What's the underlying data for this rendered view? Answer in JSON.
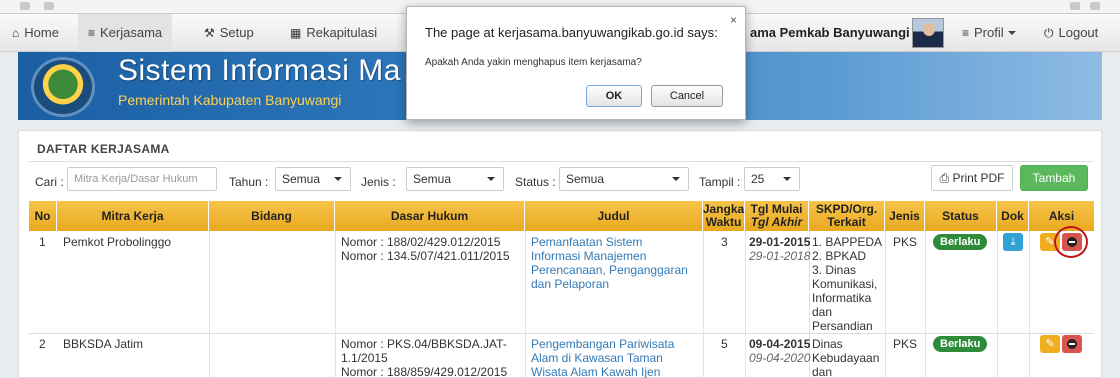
{
  "navbar": {
    "home": "Home",
    "kerjasama": "Kerjasama",
    "setup": "Setup",
    "rekapitulasi": "Rekapitulasi",
    "user": "ama Pemkab Banyuwangi",
    "profil": "Profil",
    "logout": "Logout"
  },
  "banner": {
    "title": "Sistem Informasi Ma",
    "subtitle": "Pemerintah Kabupaten Banyuwangi"
  },
  "dialog": {
    "title": "The page at kerjasama.banyuwangikab.go.id says:",
    "message": "Apakah Anda yakin menghapus item kerjasama?",
    "ok": "OK",
    "cancel": "Cancel",
    "close": "×"
  },
  "panel": {
    "title": "DAFTAR KERJASAMA"
  },
  "filters": {
    "cari_label": "Cari :",
    "cari_placeholder": "Mitra Kerja/Dasar Hukum",
    "tahun_label": "Tahun :",
    "tahun_value": "Semua",
    "jenis_label": "Jenis :",
    "jenis_value": "Semua",
    "status_label": "Status :",
    "status_value": "Semua",
    "tampil_label": "Tampil :",
    "tampil_value": "25",
    "print": "Print PDF",
    "tambah": "Tambah"
  },
  "table": {
    "headers": {
      "no": "No",
      "mitra": "Mitra Kerja",
      "bidang": "Bidang",
      "dasar": "Dasar Hukum",
      "judul": "Judul",
      "jangka_1": "Jangka",
      "jangka_2": "Waktu",
      "tgl_1": "Tgl Mulai",
      "tgl_2": "Tgl Akhir",
      "skpd_1": "SKPD/Org.",
      "skpd_2": "Terkait",
      "jenis": "Jenis",
      "status": "Status",
      "dok": "Dok",
      "aksi": "Aksi"
    },
    "rows": [
      {
        "no": "1",
        "mitra": "Pemkot Probolinggo",
        "dasar_1": "Nomor : 188/02/429.012/2015",
        "dasar_2": "Nomor : 134.5/07/421.011/2015",
        "judul": [
          "Pemanfaatan Sistem",
          "Informasi Manajemen",
          "Perencanaan, Penganggaran",
          "dan Pelaporan"
        ],
        "jangka": "3",
        "tgl_mulai": "29-01-2015",
        "tgl_akhir": "29-01-2018",
        "skpd": [
          "1. BAPPEDA",
          "2. BPKAD",
          "3. Dinas",
          "Komunikasi,",
          "Informatika",
          "dan",
          "Persandian"
        ],
        "jenis": "PKS",
        "status": "Berlaku"
      },
      {
        "no": "2",
        "mitra": "BBKSDA Jatim",
        "dasar_1": "Nomor : PKS.04/BBKSDA.JAT-",
        "dasar_2": "1.1/2015",
        "dasar_3": "Nomor : 188/859/429.012/2015",
        "judul": [
          "Pengembangan Pariwisata",
          "Alam di Kawasan Taman",
          "Wisata Alam Kawah Ijen"
        ],
        "jangka": "5",
        "tgl_mulai": "09-04-2015",
        "tgl_akhir": "09-04-2020",
        "skpd": [
          "Dinas",
          "Kebudayaan",
          "dan"
        ],
        "jenis": "PKS",
        "status": "Berlaku"
      }
    ]
  },
  "icons": {
    "home": "home-icon",
    "list": "list-icon",
    "wrench": "wrench-icon",
    "table": "table-icon",
    "power": "power-icon",
    "print": "print-icon",
    "download": "download-icon",
    "edit": "edit-icon",
    "delete": "delete-icon"
  }
}
